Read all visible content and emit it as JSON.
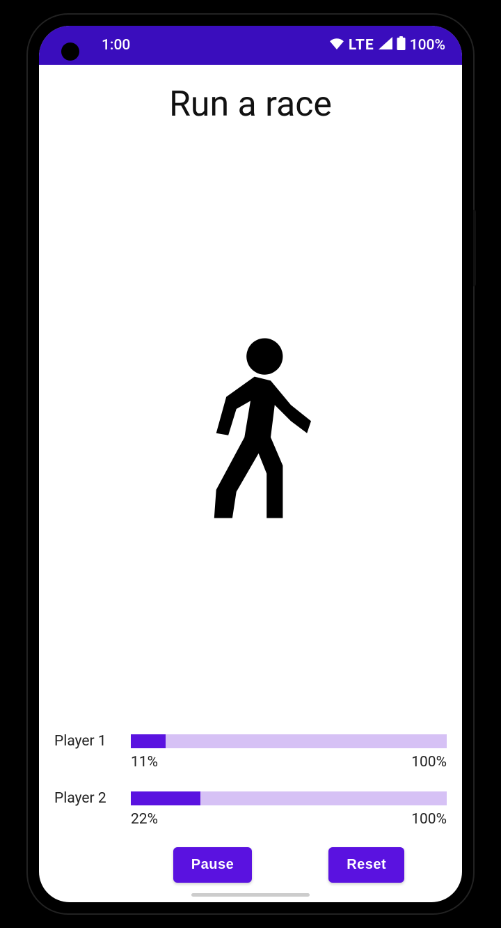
{
  "status_bar": {
    "time": "1:00",
    "network_label": "LTE",
    "battery_text": "100%"
  },
  "app": {
    "title": "Run a race",
    "icon_name": "walking-person-icon"
  },
  "players": [
    {
      "label": "Player 1",
      "progress_percent": 11,
      "progress_text": "11%",
      "max_text": "100%"
    },
    {
      "label": "Player 2",
      "progress_percent": 22,
      "progress_text": "22%",
      "max_text": "100%"
    }
  ],
  "buttons": {
    "pause": "Pause",
    "reset": "Reset"
  },
  "colors": {
    "primary": "#5a12e0",
    "primary_dark": "#3a0dbd",
    "progress_track": "#d6c1f5"
  }
}
